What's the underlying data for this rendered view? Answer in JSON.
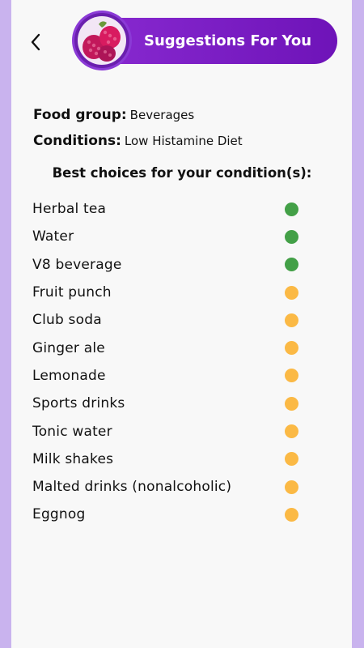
{
  "header": {
    "title": "Suggestions For You",
    "back_icon": "chevron-left-icon",
    "avatar_icon": "raspberry-image"
  },
  "meta": {
    "food_group_label": "Food group:",
    "food_group_value": "Beverages",
    "conditions_label": "Conditions:",
    "conditions_value": "Low Histamine Diet"
  },
  "subtitle": "Best choices for your condition(s):",
  "colors": {
    "good": "#43a047",
    "moderate": "#fbb945",
    "accent": "#7b1fc7"
  },
  "items": [
    {
      "name": "Herbal tea",
      "rating": "good"
    },
    {
      "name": "Water",
      "rating": "good"
    },
    {
      "name": "V8 beverage",
      "rating": "good"
    },
    {
      "name": "Fruit punch",
      "rating": "moderate"
    },
    {
      "name": "Club soda",
      "rating": "moderate"
    },
    {
      "name": "Ginger ale",
      "rating": "moderate"
    },
    {
      "name": "Lemonade",
      "rating": "moderate"
    },
    {
      "name": "Sports drinks",
      "rating": "moderate"
    },
    {
      "name": "Tonic water",
      "rating": "moderate"
    },
    {
      "name": "Milk shakes",
      "rating": "moderate"
    },
    {
      "name": "Malted drinks (nonalcoholic)",
      "rating": "moderate"
    },
    {
      "name": "Eggnog",
      "rating": "moderate"
    }
  ]
}
